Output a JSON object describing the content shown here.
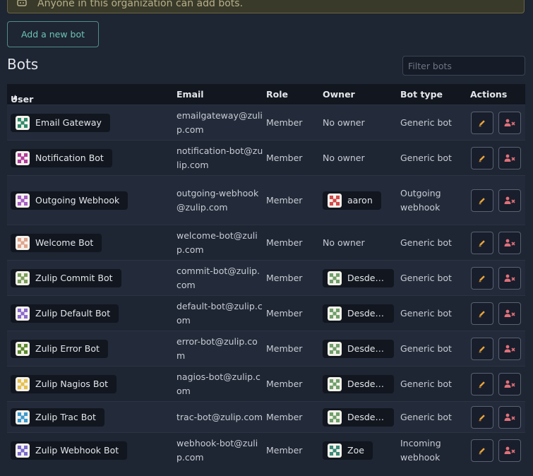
{
  "notice": "Anyone in this organization can add bots.",
  "add_bot_label": "Add a new bot",
  "heading": "Bots",
  "filter_placeholder": "Filter bots",
  "columns": {
    "user": "User",
    "email": "Email",
    "role": "Role",
    "owner": "Owner",
    "bot_type": "Bot type",
    "actions": "Actions"
  },
  "sort_indicator": "▲",
  "colors": {
    "edit": "#e8a33a",
    "deactivate": "#e0707a",
    "accent": "#6cc4b4"
  },
  "rows": [
    {
      "name": "Email Gateway",
      "email": "emailgateway@zulip.com",
      "role": "Member",
      "owner": "No owner",
      "owner_avatar": "",
      "type": "Generic bot",
      "avatar": "#2e8a6a",
      "height": 49
    },
    {
      "name": "Notification Bot",
      "email": "notification-bot@zulip.com",
      "role": "Member",
      "owner": "No owner",
      "owner_avatar": "",
      "type": "Generic bot",
      "avatar": "#b43a9e",
      "height": 49
    },
    {
      "name": "Outgoing Webhook",
      "email": "outgoing-webhook@zulip.com",
      "role": "Member",
      "owner": "aaron",
      "owner_avatar": "#d6494a",
      "type": "Outgoing webhook",
      "avatar": "#a85ec8",
      "height": 69
    },
    {
      "name": "Welcome Bot",
      "email": "welcome-bot@zulip.com",
      "role": "Member",
      "owner": "No owner",
      "owner_avatar": "",
      "type": "Generic bot",
      "avatar": "#e0a48c",
      "height": 49
    },
    {
      "name": "Zulip Commit Bot",
      "email": "commit-bot@zulip.com",
      "role": "Member",
      "owner": "Desdemona",
      "owner_avatar": "#6fa06a",
      "type": "Generic bot",
      "avatar": "#7aa05a",
      "height": 49
    },
    {
      "name": "Zulip Default Bot",
      "email": "default-bot@zulip.com",
      "role": "Member",
      "owner": "Desdemona",
      "owner_avatar": "#6fa06a",
      "type": "Generic bot",
      "avatar": "#8a6ad0",
      "height": 49
    },
    {
      "name": "Zulip Error Bot",
      "email": "error-bot@zulip.com",
      "role": "Member",
      "owner": "Desdemona",
      "owner_avatar": "#6fa06a",
      "type": "Generic bot",
      "avatar": "#5a8a2a",
      "height": 49
    },
    {
      "name": "Zulip Nagios Bot",
      "email": "nagios-bot@zulip.com",
      "role": "Member",
      "owner": "Desdemona",
      "owner_avatar": "#6fa06a",
      "type": "Generic bot",
      "avatar": "#e6c04a",
      "height": 49
    },
    {
      "name": "Zulip Trac Bot",
      "email": "trac-bot@zulip.com",
      "role": "Member",
      "owner": "Desdemona",
      "owner_avatar": "#6fa06a",
      "type": "Generic bot",
      "avatar": "#3a9ad0",
      "height": 43
    },
    {
      "name": "Zulip Webhook Bot",
      "email": "webhook-bot@zulip.com",
      "role": "Member",
      "owner": "Zoe",
      "owner_avatar": "#3a8a7a",
      "type": "Incoming webhook",
      "avatar": "#7a6ad0",
      "height": 49
    }
  ]
}
